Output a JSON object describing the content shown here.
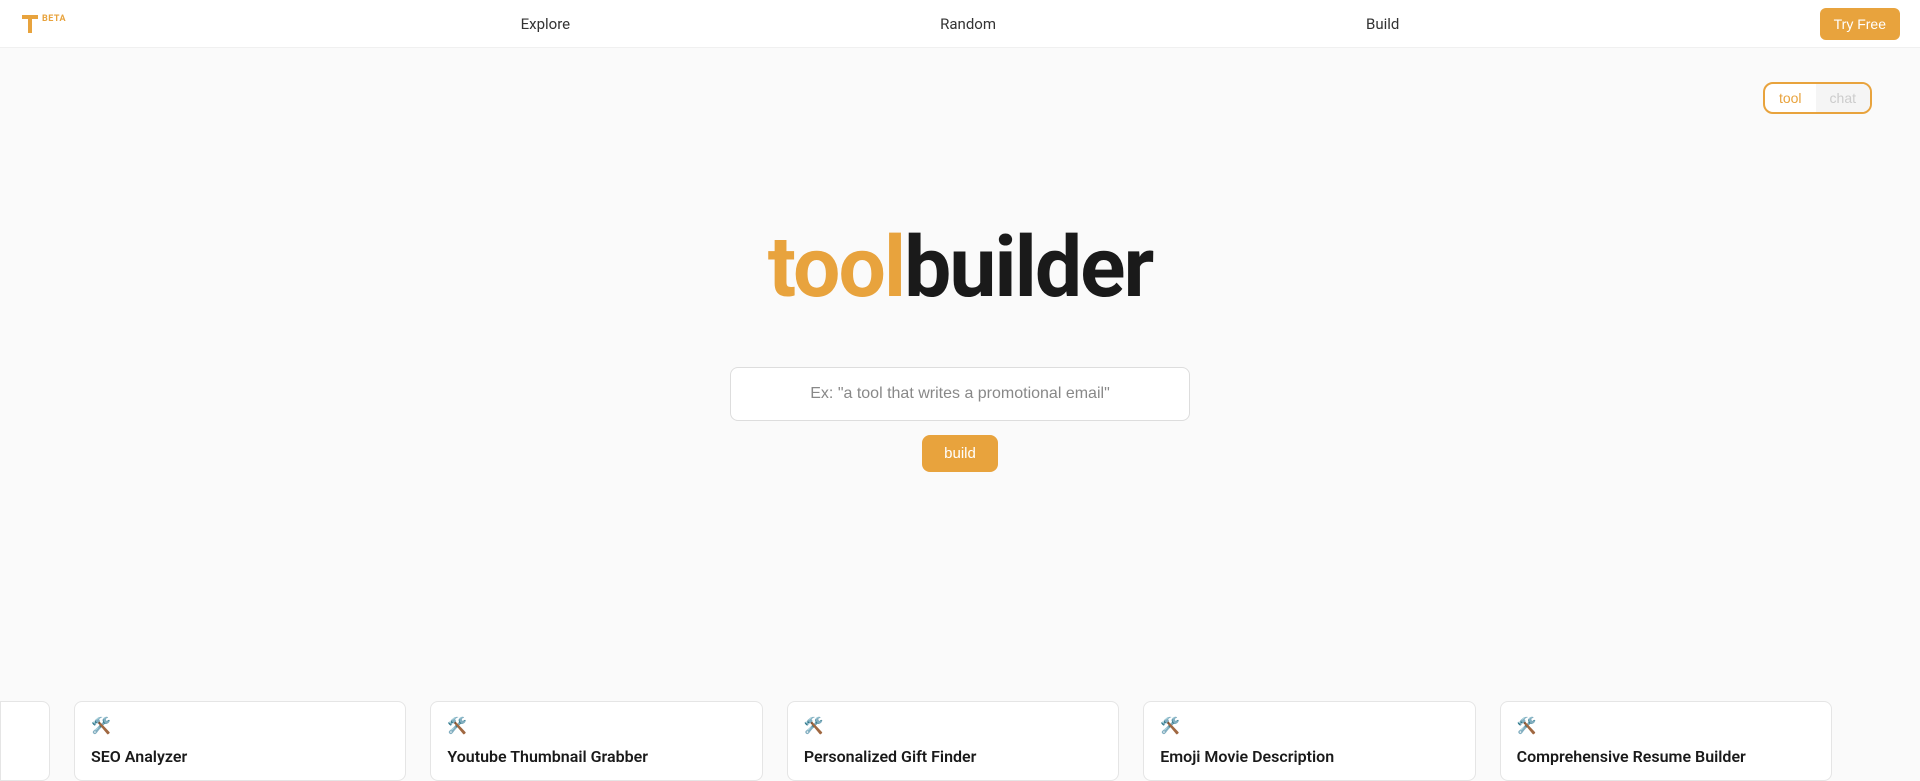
{
  "header": {
    "beta_label": "BETA",
    "nav": {
      "explore": "Explore",
      "random": "Random",
      "build": "Build"
    },
    "try_free": "Try Free"
  },
  "toggle": {
    "tool": "tool",
    "chat": "chat"
  },
  "main": {
    "title_tool": "tool",
    "title_builder": "builder",
    "input_placeholder": "Ex: \"a tool that writes a promotional email\"",
    "build_button": "build"
  },
  "cards": [
    {
      "icon": "🛠️",
      "title": "SEO Analyzer"
    },
    {
      "icon": "🛠️",
      "title": "Youtube Thumbnail Grabber"
    },
    {
      "icon": "🛠️",
      "title": "Personalized Gift Finder"
    },
    {
      "icon": "🛠️",
      "title": "Emoji Movie Description"
    },
    {
      "icon": "🛠️",
      "title": "Comprehensive Resume Builder"
    }
  ]
}
